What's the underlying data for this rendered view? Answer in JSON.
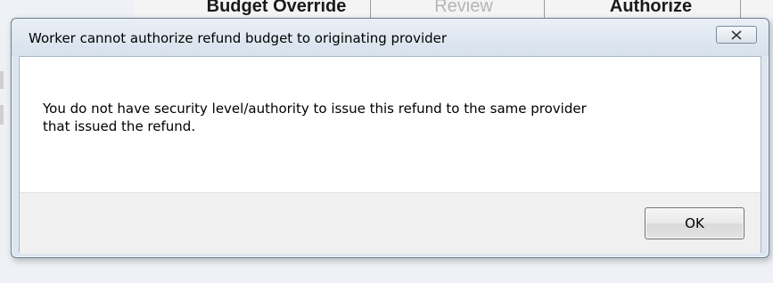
{
  "background": {
    "tabs": {
      "budget_override": "Budget Override",
      "review": "Review",
      "authorize": "Authorize"
    }
  },
  "dialog": {
    "title": "Worker cannot authorize refund budget to originating provider",
    "message_line1": "You do not have security level/authority to issue this refund to the same provider",
    "message_line2": "that issued the refund.",
    "ok_label": "OK",
    "close_icon": "close-icon"
  }
}
